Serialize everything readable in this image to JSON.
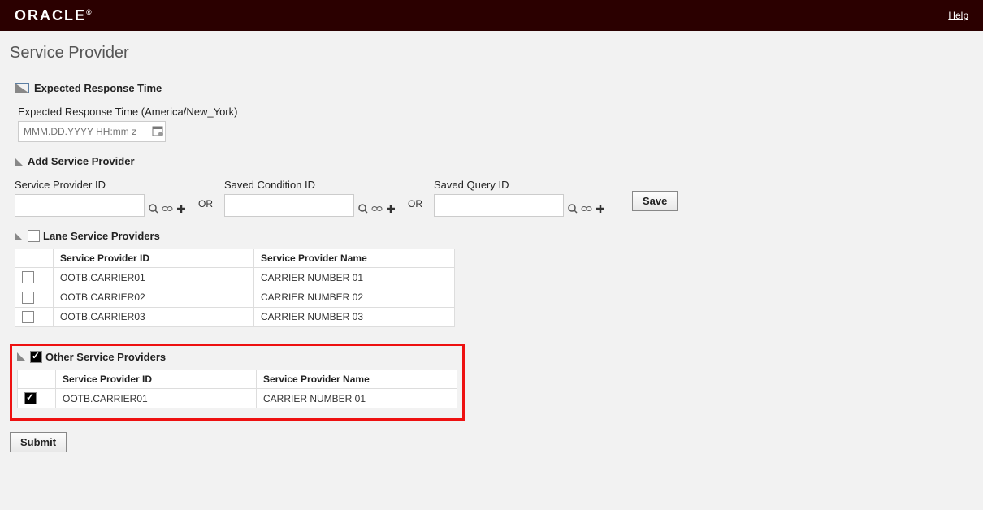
{
  "header": {
    "logo": "ORACLE",
    "help": "Help"
  },
  "page_title": "Service Provider",
  "sections": {
    "expected_response": {
      "heading": "Expected Response Time",
      "field_label": "Expected Response Time (America/New_York)",
      "placeholder": "MMM.DD.YYYY HH:mm z"
    },
    "add_sp": {
      "heading": "Add Service Provider",
      "sp_id_label": "Service Provider ID",
      "saved_cond_label": "Saved Condition ID",
      "saved_query_label": "Saved Query ID",
      "or_text": "OR",
      "save_button": "Save"
    },
    "lane_sp": {
      "heading": "Lane Service Providers",
      "col_id": "Service Provider ID",
      "col_name": "Service Provider Name",
      "rows": [
        {
          "id": "OOTB.CARRIER01",
          "name": "CARRIER NUMBER 01",
          "checked": false
        },
        {
          "id": "OOTB.CARRIER02",
          "name": "CARRIER NUMBER 02",
          "checked": false
        },
        {
          "id": "OOTB.CARRIER03",
          "name": "CARRIER NUMBER 03",
          "checked": false
        }
      ]
    },
    "other_sp": {
      "heading": "Other Service Providers",
      "col_id": "Service Provider ID",
      "col_name": "Service Provider Name",
      "rows": [
        {
          "id": "OOTB.CARRIER01",
          "name": "CARRIER NUMBER 01",
          "checked": true
        }
      ]
    },
    "submit_button": "Submit"
  }
}
